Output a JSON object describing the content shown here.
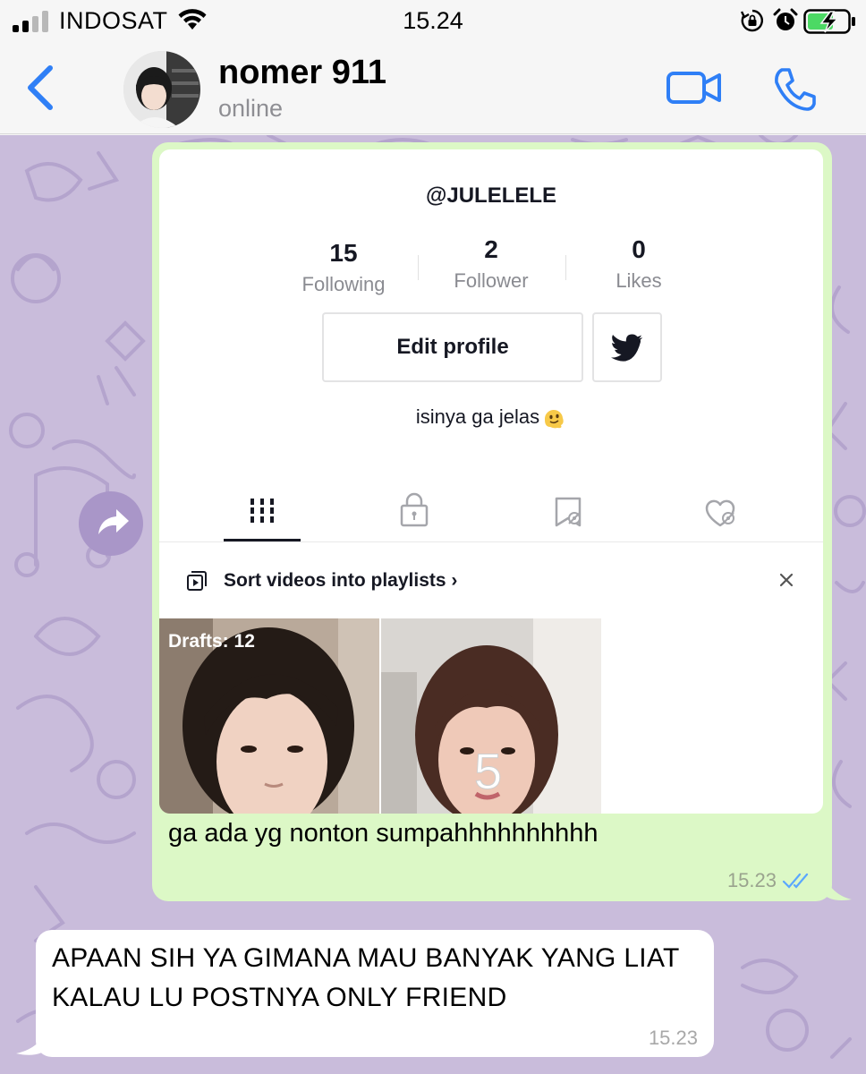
{
  "status_bar": {
    "carrier": "INDOSAT",
    "time": "15.24",
    "signal_bars": 2,
    "battery_state": "charging"
  },
  "chat_header": {
    "contact_name": "nomer 911",
    "contact_status": "online",
    "back_icon": "chevron-left-icon",
    "video_icon": "video-camera-icon",
    "call_icon": "phone-icon",
    "accent_color": "#2f7ff6"
  },
  "messages": [
    {
      "direction": "outgoing",
      "type": "image",
      "screenshot": {
        "handle": "@JULELELE",
        "stats": [
          {
            "value": "15",
            "label": "Following"
          },
          {
            "value": "2",
            "label": "Follower"
          },
          {
            "value": "0",
            "label": "Likes"
          }
        ],
        "edit_profile_label": "Edit profile",
        "bio": "isinya ga jelas",
        "tabs": [
          "videos-grid-icon",
          "lock-icon",
          "saved-icon",
          "liked-icon"
        ],
        "playlist_prompt": "Sort videos into playlists",
        "playlist_arrow": "›",
        "close_label": "×",
        "drafts_label": "Drafts: 12"
      },
      "text": "ga ada yg nonton sumpahhhhhhhhhh",
      "time": "15.23",
      "status": "read"
    },
    {
      "direction": "incoming",
      "type": "text",
      "text": "APAAN SIH YA GIMANA MAU BANYAK YANG LIAT KALAU LU POSTNYA ONLY FRIEND",
      "time": "15.23"
    }
  ],
  "colors": {
    "outgoing_bubble": "#dcf8c6",
    "incoming_bubble": "#ffffff",
    "wallpaper": "#c9bcdb",
    "read_ticks": "#5aa7ff"
  }
}
